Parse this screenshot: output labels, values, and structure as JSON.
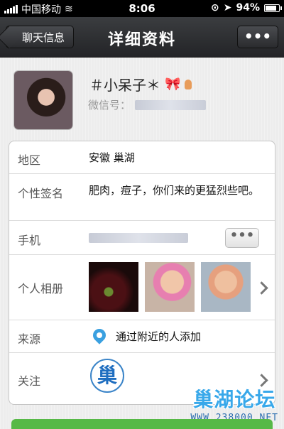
{
  "status_bar": {
    "carrier": "中国移动",
    "time": "8:06",
    "battery": "94%",
    "battery_level": 0.94
  },
  "nav": {
    "back_label": "聊天信息",
    "title": "详细资料",
    "more_label": "•••"
  },
  "profile": {
    "name": "＃小呆子＊",
    "wechat_id_label": "微信号：",
    "icons": [
      "bow-icon",
      "female-icon"
    ]
  },
  "details": {
    "region_label": "地区",
    "region_value": "安徽 巢湖",
    "signature_label": "个性签名",
    "signature_value": "肥肉，痘子，你们来的更猛烈些吧。",
    "phone_label": "手机",
    "phone_more_label": "•••",
    "album_label": "个人相册",
    "source_label": "来源",
    "source_value": "通过附近的人添加",
    "follow_label": "关注",
    "follow_logo_text": "巢"
  },
  "watermark": {
    "title": "巢湖论坛",
    "url": "WWW.238000.NET"
  },
  "colors": {
    "nav_bg": "#2c2d30",
    "watermark_blue": "#38a8ea",
    "accent_green": "#57b947"
  }
}
